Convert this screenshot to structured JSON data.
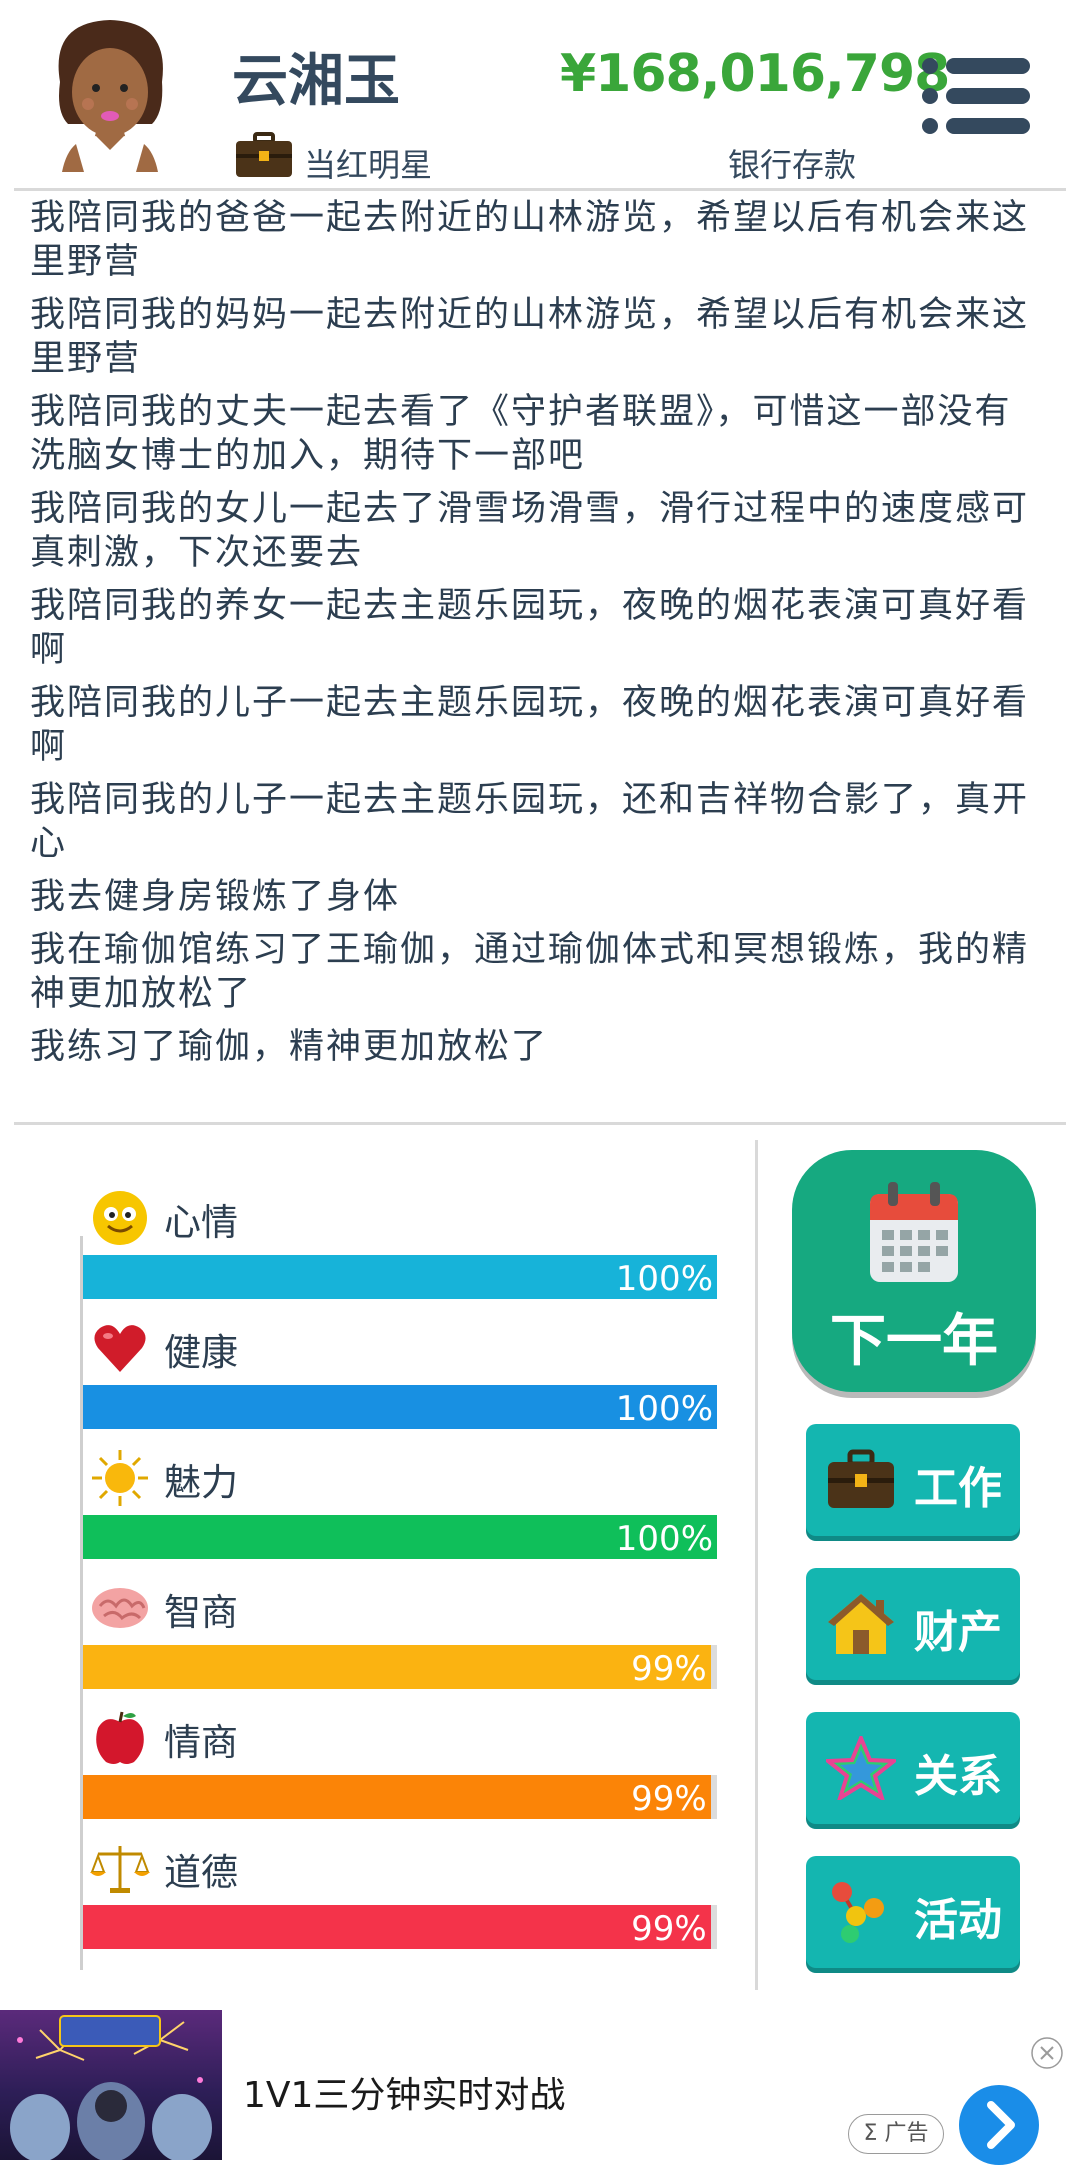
{
  "header": {
    "name": "云湘玉",
    "money": "¥168,016,798",
    "job_label": "当红明星",
    "bank_label": "银行存款",
    "avatar_icon": "woman-avatar-icon",
    "menu_icon": "menu-list-icon"
  },
  "log": [
    "我陪同我的爸爸一起去附近的山林游览，希望以后有机会来这里野营",
    "我陪同我的妈妈一起去附近的山林游览，希望以后有机会来这里野营",
    "我陪同我的丈夫一起去看了《守护者联盟》，可惜这一部没有洗脑女博士的加入，期待下一部吧",
    "我陪同我的女儿一起去了滑雪场滑雪，滑行过程中的速度感可真刺激，下次还要去",
    "我陪同我的养女一起去主题乐园玩，夜晚的烟花表演可真好看啊",
    "我陪同我的儿子一起去主题乐园玩，夜晚的烟花表演可真好看啊",
    "我陪同我的儿子一起去主题乐园玩，还和吉祥物合影了，真开心",
    "我去健身房锻炼了身体",
    "我在瑜伽馆练习了王瑜伽，通过瑜伽体式和冥想锻炼，我的精神更加放松了",
    "我练习了瑜伽，精神更加放松了"
  ],
  "stats": [
    {
      "label": "心情",
      "percent_text": "100%",
      "value": 100,
      "color": "#17b3d9",
      "icon": "smiley-icon"
    },
    {
      "label": "健康",
      "percent_text": "100%",
      "value": 100,
      "color": "#1890e2",
      "icon": "heart-icon"
    },
    {
      "label": "魅力",
      "percent_text": "100%",
      "value": 100,
      "color": "#0fbf5a",
      "icon": "sun-icon"
    },
    {
      "label": "智商",
      "percent_text": "99%",
      "value": 99,
      "color": "#fbb311",
      "icon": "brain-icon"
    },
    {
      "label": "情商",
      "percent_text": "99%",
      "value": 99,
      "color": "#fb8407",
      "icon": "apple-icon"
    },
    {
      "label": "道德",
      "percent_text": "99%",
      "value": 99,
      "color": "#f4334a",
      "icon": "scales-icon"
    }
  ],
  "actions": {
    "next_year": "下一年",
    "work": "工作",
    "property": "财产",
    "relations": "关系",
    "activity": "活动"
  },
  "ad": {
    "text": "1V1三分钟实时对战",
    "badge": "Σ 广告"
  }
}
